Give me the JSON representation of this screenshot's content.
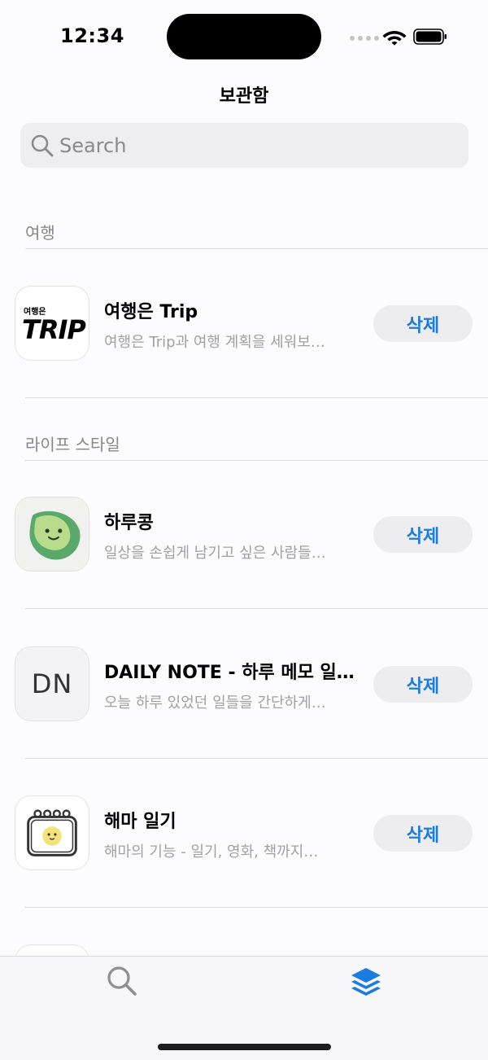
{
  "status": {
    "time": "12:34"
  },
  "nav": {
    "title": "보관함"
  },
  "search": {
    "placeholder": "Search"
  },
  "sections": [
    {
      "header": "여행"
    },
    {
      "header": "라이프 스타일"
    }
  ],
  "apps": [
    {
      "name": "여행은 Trip",
      "description": "여행은 Trip과 여행 계획을 세워보…",
      "icon_text_small": "여행은",
      "icon_text_big": "TRIP"
    },
    {
      "name": "하루콩",
      "description": "일상을 손쉽게 남기고 싶은 사람들…"
    },
    {
      "name": "DAILY NOTE - 하루 메모 일…",
      "description": "오늘 하루 있었던 일들을 간단하게…",
      "icon_text": "DN"
    },
    {
      "name": "해마 일기",
      "description": "해마의 기능 - 일기, 영화, 책까지…"
    }
  ],
  "actions": {
    "delete_label": "삭제"
  },
  "colors": {
    "accent": "#1a7ce0",
    "secondary_text": "#a0a0a5",
    "button_bg": "#ededf0"
  }
}
